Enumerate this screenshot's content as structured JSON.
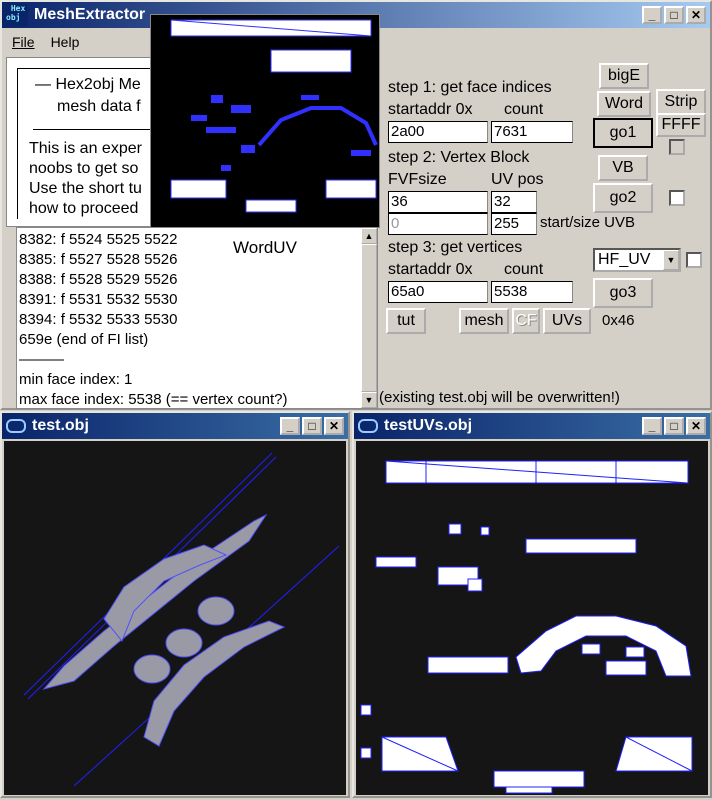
{
  "main_window": {
    "title": "MeshExtractor",
    "icon_text": "Hex obj",
    "menu": [
      "File",
      "Help"
    ],
    "info_lines": [
      "—   Hex2obj Me",
      "mesh data f",
      "This is an exper",
      "noobs to get so",
      "Use the short tu",
      "how to proceed"
    ],
    "log_lines": [
      "8382: f  5524 5525 5522",
      "8385: f  5527 5528 5526",
      "8388: f  5528 5529 5526",
      "8391: f  5531 5532 5530",
      "8394: f  5532 5533 5530",
      "659e (end of FI list)",
      "———",
      "min face index: 1",
      "max face index: 5538 (== vertex count?)"
    ],
    "overlay_label": "WordUV",
    "step1": {
      "title": "step 1: get face indices",
      "addr_label": "startaddr 0x",
      "count_label": "count",
      "addr": "2a00",
      "count": "7631"
    },
    "step2": {
      "title": "step 2: Vertex Block",
      "fvf_label": "FVFsize",
      "uv_label": "UV pos",
      "fvf": "36",
      "uvpos": "32",
      "start_uvb": "0",
      "size_uvb": "255",
      "uvb_label": "start/size UVB"
    },
    "step3": {
      "title": "step 3: get vertices",
      "addr_label": "startaddr 0x",
      "count_label": "count",
      "addr": "65a0",
      "count": "5538"
    },
    "buttons": {
      "bigE": "bigE",
      "word": "Word",
      "strip": "Strip",
      "ffff": "FFFF",
      "go1": "go1",
      "vb": "VB",
      "go2": "go2",
      "go3": "go3",
      "tut": "tut",
      "mesh": "mesh",
      "cf": "CF",
      "uvs": "UVs"
    },
    "dropdown_value": "HF_UV",
    "hex_readout": "0x46",
    "status": "(existing test.obj will be overwritten!)"
  },
  "mesh_window": {
    "title": "test.obj"
  },
  "uv_window": {
    "title": "testUVs.obj"
  },
  "colors": {
    "titlebar_active": "#0a246a",
    "mesh_line": "#2020ff",
    "viewport_bg": "#151515"
  }
}
